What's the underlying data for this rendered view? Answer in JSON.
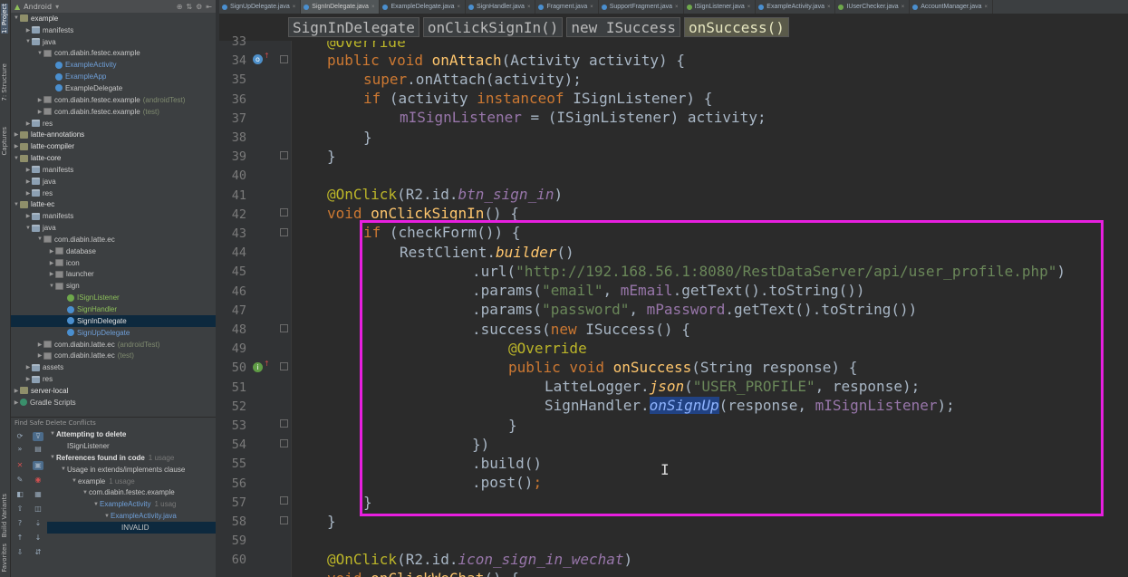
{
  "left_tabs": [
    "1: Project",
    "7: Structure",
    "Captures",
    "Build Variants",
    "Favorites"
  ],
  "project_header": {
    "title": "Android"
  },
  "tree": [
    {
      "label": "example",
      "style": "strong",
      "icon": "module",
      "indent": 0,
      "arrow": "▼"
    },
    {
      "label": "manifests",
      "icon": "folder",
      "indent": 1,
      "arrow": "▶"
    },
    {
      "label": "java",
      "icon": "folder",
      "indent": 1,
      "arrow": "▼"
    },
    {
      "label": "com.diabin.festec.example",
      "icon": "pkg",
      "indent": 2,
      "arrow": "▼"
    },
    {
      "label": "ExampleActivity",
      "style": "blue",
      "icon": "cls",
      "indent": 3,
      "arrow": ""
    },
    {
      "label": "ExampleApp",
      "style": "blue",
      "icon": "cls",
      "indent": 3,
      "arrow": ""
    },
    {
      "label": "ExampleDelegate",
      "icon": "cls",
      "indent": 3,
      "arrow": ""
    },
    {
      "label": "com.diabin.festec.example",
      "suffix": "(androidTest)",
      "icon": "pkg",
      "indent": 2,
      "arrow": "▶"
    },
    {
      "label": "com.diabin.festec.example",
      "suffix": "(test)",
      "icon": "pkg",
      "indent": 2,
      "arrow": "▶"
    },
    {
      "label": "res",
      "icon": "folder",
      "indent": 1,
      "arrow": "▶"
    },
    {
      "label": "latte-annotations",
      "style": "strong",
      "icon": "module",
      "indent": 0,
      "arrow": "▶"
    },
    {
      "label": "latte-compiler",
      "style": "strong",
      "icon": "module",
      "indent": 0,
      "arrow": "▶"
    },
    {
      "label": "latte-core",
      "style": "strong",
      "icon": "module",
      "indent": 0,
      "arrow": "▼"
    },
    {
      "label": "manifests",
      "icon": "folder",
      "indent": 1,
      "arrow": "▶"
    },
    {
      "label": "java",
      "icon": "folder",
      "indent": 1,
      "arrow": "▶"
    },
    {
      "label": "res",
      "icon": "folder",
      "indent": 1,
      "arrow": "▶"
    },
    {
      "label": "latte-ec",
      "style": "strong",
      "icon": "module",
      "indent": 0,
      "arrow": "▼"
    },
    {
      "label": "manifests",
      "icon": "folder",
      "indent": 1,
      "arrow": "▶"
    },
    {
      "label": "java",
      "icon": "folder",
      "indent": 1,
      "arrow": "▼"
    },
    {
      "label": "com.diabin.latte.ec",
      "icon": "pkg",
      "indent": 2,
      "arrow": "▼"
    },
    {
      "label": "database",
      "icon": "pkg",
      "indent": 3,
      "arrow": "▶"
    },
    {
      "label": "icon",
      "icon": "pkg",
      "indent": 3,
      "arrow": "▶"
    },
    {
      "label": "launcher",
      "icon": "pkg",
      "indent": 3,
      "arrow": "▶"
    },
    {
      "label": "sign",
      "icon": "pkg",
      "indent": 3,
      "arrow": "▼"
    },
    {
      "label": "ISignListener",
      "style": "green",
      "icon": "intf",
      "indent": 4,
      "arrow": ""
    },
    {
      "label": "SignHandler",
      "style": "green",
      "icon": "cls",
      "indent": 4,
      "arrow": ""
    },
    {
      "label": "SignInDelegate",
      "style": "strong",
      "icon": "cls",
      "indent": 4,
      "arrow": "",
      "selected": true
    },
    {
      "label": "SignUpDelegate",
      "style": "blue",
      "icon": "cls",
      "indent": 4,
      "arrow": ""
    },
    {
      "label": "com.diabin.latte.ec",
      "suffix": "(androidTest)",
      "icon": "pkg",
      "indent": 2,
      "arrow": "▶"
    },
    {
      "label": "com.diabin.latte.ec",
      "suffix": "(test)",
      "icon": "pkg",
      "indent": 2,
      "arrow": "▶"
    },
    {
      "label": "assets",
      "icon": "folder",
      "indent": 1,
      "arrow": "▶"
    },
    {
      "label": "res",
      "icon": "folder",
      "indent": 1,
      "arrow": "▶"
    },
    {
      "label": "server-local",
      "style": "strong",
      "icon": "module",
      "indent": 0,
      "arrow": "▶"
    },
    {
      "label": "Gradle Scripts",
      "icon": "gradle",
      "indent": 0,
      "arrow": "▶"
    }
  ],
  "find_panel": {
    "title": "Find Safe Delete Conflicts",
    "rows": [
      {
        "label": "Attempting to delete",
        "indent": 0,
        "arrow": "▼",
        "strong": true
      },
      {
        "label": "ISignListener",
        "indent": 1,
        "arrow": ""
      },
      {
        "label": "References found in code",
        "count": "1 usage",
        "indent": 0,
        "arrow": "▼",
        "strong": true
      },
      {
        "label": "Usage in extends/implements clause",
        "indent": 1,
        "arrow": "▼"
      },
      {
        "label": "example",
        "count": "1 usage",
        "indent": 2,
        "arrow": "▼"
      },
      {
        "label": "com.diabin.festec.example",
        "indent": 3,
        "arrow": "▼"
      },
      {
        "label": "ExampleActivity",
        "count": "1 usag",
        "indent": 4,
        "arrow": "▼",
        "blue": true
      },
      {
        "label": "ExampleActivity.java",
        "indent": 5,
        "arrow": "▼",
        "blue": true
      },
      {
        "label": "INVALID",
        "indent": 6,
        "arrow": "",
        "selected": true
      }
    ]
  },
  "tabs": [
    {
      "label": "SignUpDelegate.java",
      "icon": "cls"
    },
    {
      "label": "SignInDelegate.java",
      "icon": "cls",
      "active": true
    },
    {
      "label": "ExampleDelegate.java",
      "icon": "cls"
    },
    {
      "label": "SignHandler.java",
      "icon": "cls"
    },
    {
      "label": "Fragment.java",
      "icon": "cls"
    },
    {
      "label": "SupportFragment.java",
      "icon": "cls"
    },
    {
      "label": "ISignListener.java",
      "icon": "i"
    },
    {
      "label": "ExampleActivity.java",
      "icon": "cls"
    },
    {
      "label": "IUserChecker.java",
      "icon": "i"
    },
    {
      "label": "AccountManager.java",
      "icon": "cls"
    }
  ],
  "breadcrumbs": [
    "SignInDelegate",
    "onClickSignIn()",
    "new ISuccess",
    "onSuccess()"
  ],
  "line_numbers": [
    "33",
    "34",
    "35",
    "36",
    "37",
    "38",
    "39",
    "40",
    "41",
    "42",
    "43",
    "44",
    "45",
    "46",
    "47",
    "48",
    "49",
    "50",
    "51",
    "52",
    "53",
    "54",
    "55",
    "56",
    "57",
    "58",
    "59",
    "60"
  ],
  "code": {
    "l33": {
      "a": "@Override"
    },
    "l34": {
      "kw1": "public void ",
      "fn": "onAttach",
      "rest": "(Activity activity) {"
    },
    "l35": {
      "kw1": "super",
      "rest": ".onAttach(activity);"
    },
    "l36": {
      "kw1": "if ",
      "rest1": "(activity ",
      "kw2": "instanceof ",
      "rest2": "ISignListener) {"
    },
    "l37": {
      "fld": "mISignListener",
      "rest": " = (ISignListener) activity;"
    },
    "l38": {
      "rest": "}"
    },
    "l39": {
      "rest": "}"
    },
    "l41": {
      "an": "@OnClick",
      "rest1": "(R2.id.",
      "it": "btn_sign_in",
      "rest2": ")"
    },
    "l42": {
      "kw1": "void ",
      "fn": "onClickSignIn",
      "rest": "() {"
    },
    "l43": {
      "kw1": "if ",
      "rest": "(checkForm()) {"
    },
    "l44": {
      "rest1": "RestClient.",
      "st": "builder",
      "rest2": "()"
    },
    "l45": {
      "rest1": ".url(",
      "str": "\"http://192.168.56.1:8080/RestDataServer/api/user_profile.php\"",
      "rest2": ")"
    },
    "l46": {
      "rest1": ".params(",
      "str": "\"email\"",
      "rest2": ", ",
      "fld": "mEmail",
      "rest3": ".getText().toString())"
    },
    "l47": {
      "rest1": ".params(",
      "str": "\"password\"",
      "rest2": ", ",
      "fld": "mPassword",
      "rest3": ".getText().toString())"
    },
    "l48": {
      "rest1": ".success(",
      "kw1": "new ",
      "rest2": "ISuccess() {"
    },
    "l49": {
      "an": "@Override"
    },
    "l50": {
      "kw1": "public void ",
      "fn": "onSuccess",
      "rest": "(String response) {"
    },
    "l51": {
      "rest1": "LatteLogger.",
      "st": "json",
      "rest2": "(",
      "str": "\"USER_PROFILE\"",
      "rest3": ", response);"
    },
    "l52": {
      "rest1": "SignHandler.",
      "sel": "onSignUp",
      "rest2": "(response, ",
      "fld": "mISignListener",
      "rest3": ");"
    },
    "l53": {
      "rest": "}"
    },
    "l54": {
      "rest": "})"
    },
    "l55": {
      "rest": ".build()"
    },
    "l56": {
      "rest1": ".post()",
      "kw1": ";"
    },
    "l57": {
      "rest": "}"
    },
    "l58": {
      "rest": "}"
    },
    "l60": {
      "an": "@OnClick",
      "rest1": "(R2.id.",
      "it": "icon_sign_in_wechat",
      "rest2": ")"
    },
    "l61": {
      "kw1": "void ",
      "fn": "onClickWeChat",
      "rest": "() {"
    }
  },
  "colors": {
    "highlight": "#e81fe0",
    "keyword": "#cc7832",
    "method": "#ffc66d",
    "string": "#6a8759",
    "field": "#9876aa",
    "annotation": "#bbb529"
  }
}
